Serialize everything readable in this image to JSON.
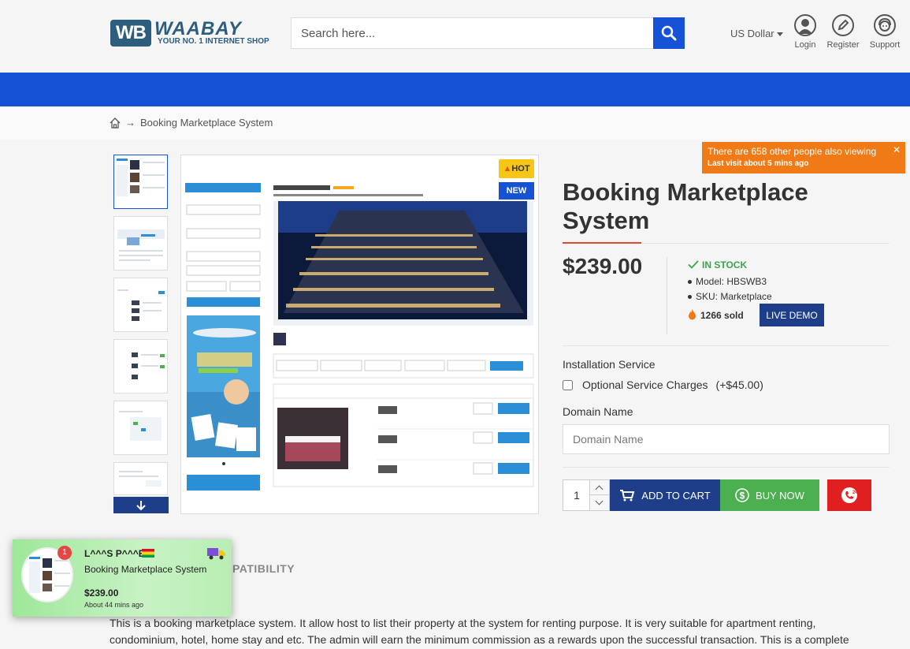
{
  "brand": {
    "logo_short": "WB",
    "logo_name": "WAABAY",
    "tagline": "YOUR NO. 1 INTERNET SHOP"
  },
  "search": {
    "placeholder": "Search here..."
  },
  "header": {
    "currency": "US Dollar",
    "login": "Login",
    "register": "Register",
    "support": "Support"
  },
  "breadcrumb": {
    "current": "Booking Marketplace System",
    "separator": "→"
  },
  "badges": {
    "hot": "HOT",
    "new": "NEW"
  },
  "viewing_notice": {
    "text": "There are 658 other people also viewing",
    "subtext": "Last visit about 5 mins ago"
  },
  "product": {
    "title": "Booking Marketplace System",
    "price": "$239.00",
    "stock": "IN STOCK",
    "model": "Model: HBSWB3",
    "sku": "SKU: Marketplace",
    "sold": "1266 sold",
    "live_demo": "LIVE DEMO"
  },
  "options": {
    "installation_title": "Installation Service",
    "service_label": "Optional Service Charges",
    "service_price": "(+$45.00)",
    "domain_title": "Domain Name",
    "domain_placeholder": "Domain Name"
  },
  "cart": {
    "quantity": "1",
    "add_to_cart": "ADD TO CART",
    "buy_now": "BUY NOW"
  },
  "section": {
    "compatibility": "PATIBILITY"
  },
  "description": "This is a booking marketplace system. It allow host to list their property at the system for renting purpose. It is very suitable for apartment renting, condominium, hotel, home stay and etc. The admin will earn the minimum commission as a rewards upon the successful transaction. This is a complete",
  "recent_purchase": {
    "count": "1",
    "buyer": "L^^^S P^^^E",
    "product": "Booking Marketplace System",
    "price": "$239.00",
    "time": "About 44 mins ago"
  },
  "colors": {
    "primary": "#1552d6",
    "dark_blue": "#1e3e8a",
    "green": "#4caf50",
    "red": "#e02020",
    "orange": "#f07b16",
    "stock_green": "#3aa64a"
  }
}
